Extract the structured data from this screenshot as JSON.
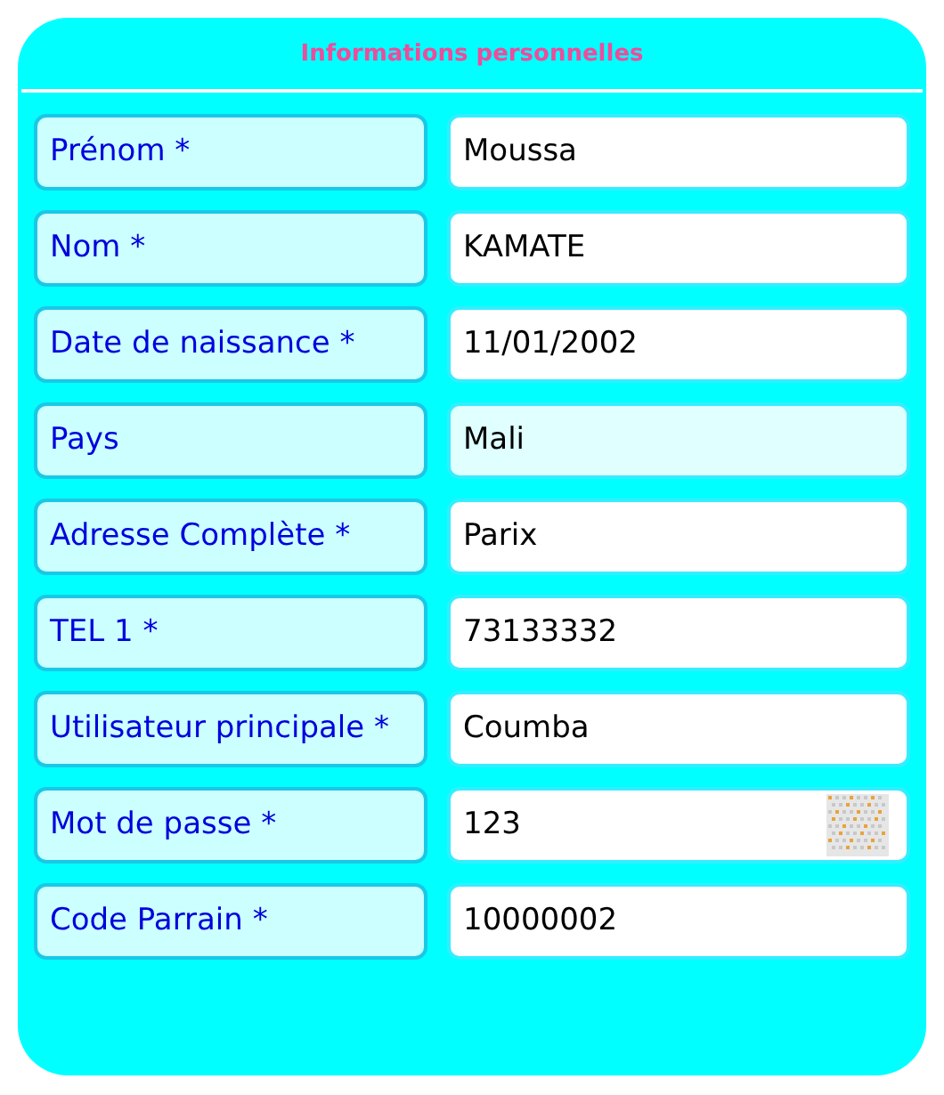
{
  "title": "Informations personnelles",
  "fields": [
    {
      "label": "Prénom *",
      "value": "Moussa",
      "disabled": false,
      "kind": "text"
    },
    {
      "label": "Nom *",
      "value": "KAMATE",
      "disabled": false,
      "kind": "text"
    },
    {
      "label": "Date de naissance *",
      "value": "11/01/2002",
      "disabled": false,
      "kind": "text"
    },
    {
      "label": "Pays",
      "value": "Mali",
      "disabled": true,
      "kind": "text"
    },
    {
      "label": "Adresse Complète *",
      "value": "Parix",
      "disabled": false,
      "kind": "text"
    },
    {
      "label": "TEL 1 *",
      "value": "73133332",
      "disabled": false,
      "kind": "text"
    },
    {
      "label": "Utilisateur principale *",
      "value": "Coumba",
      "disabled": false,
      "kind": "text"
    },
    {
      "label": "Mot de passe *",
      "value": "123",
      "disabled": false,
      "kind": "password"
    },
    {
      "label": "Code Parrain *",
      "value": "10000002",
      "disabled": false,
      "kind": "text"
    }
  ]
}
